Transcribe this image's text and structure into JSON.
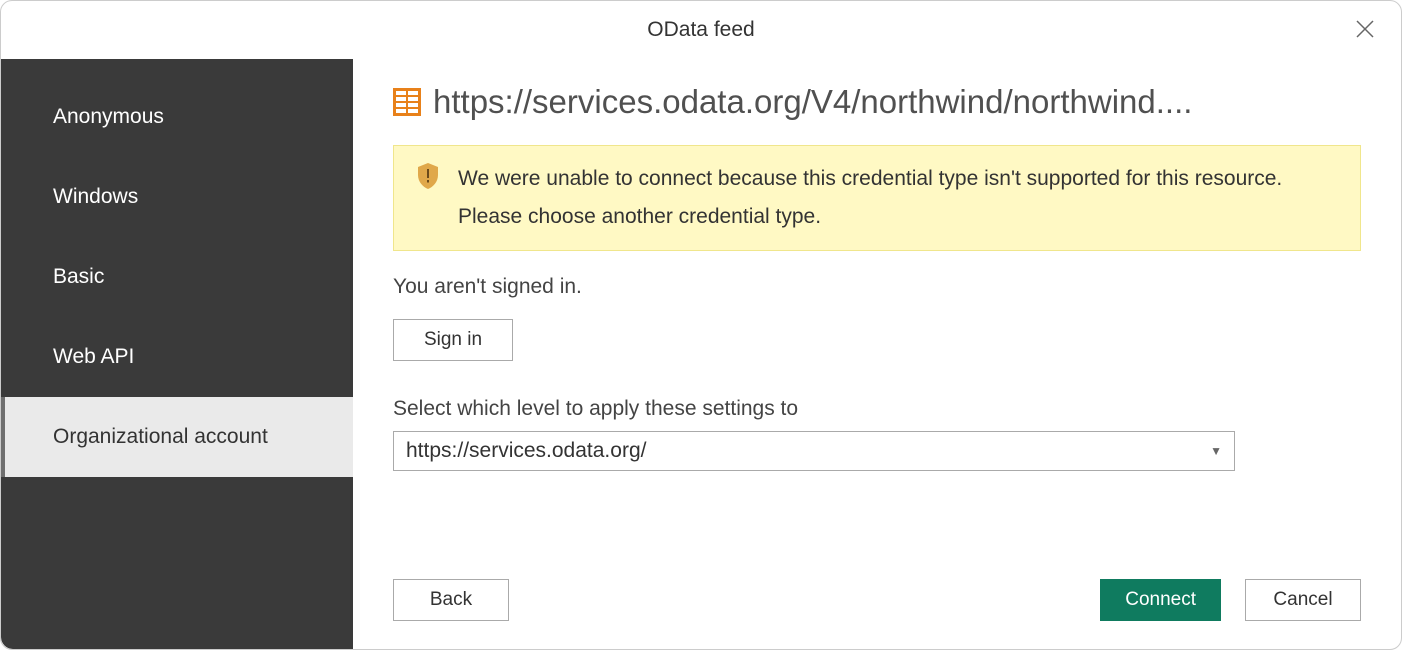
{
  "dialog": {
    "title": "OData feed"
  },
  "url": "https://services.odata.org/V4/northwind/northwind....",
  "warning": {
    "message": "We were unable to connect because this credential type isn't supported for this resource. Please choose another credential type."
  },
  "sidebar": {
    "items": [
      {
        "label": "Anonymous",
        "selected": false
      },
      {
        "label": "Windows",
        "selected": false
      },
      {
        "label": "Basic",
        "selected": false
      },
      {
        "label": "Web API",
        "selected": false
      },
      {
        "label": "Organizational account",
        "selected": true
      }
    ]
  },
  "status": {
    "text": "You aren't signed in.",
    "signin_label": "Sign in"
  },
  "level": {
    "label": "Select which level to apply these settings to",
    "value": "https://services.odata.org/"
  },
  "buttons": {
    "back": "Back",
    "connect": "Connect",
    "cancel": "Cancel"
  }
}
